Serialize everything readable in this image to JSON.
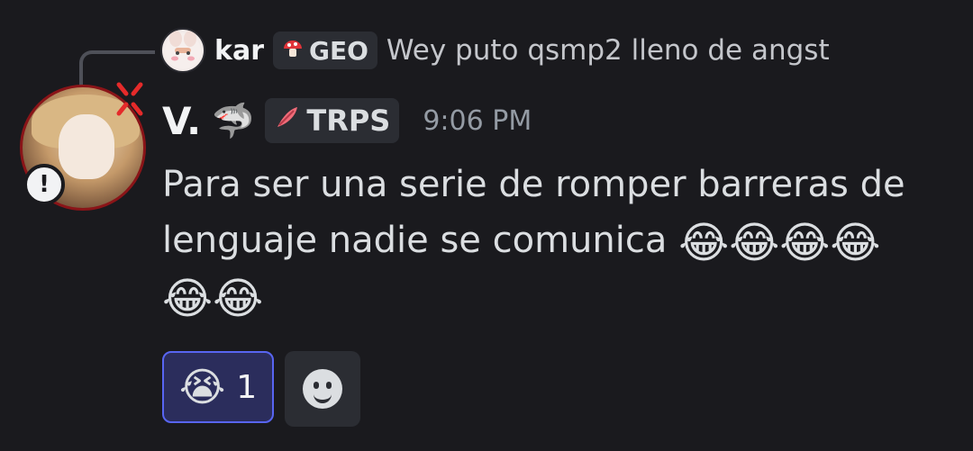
{
  "reply": {
    "author": "kar",
    "tag_icon": "mushroom-icon",
    "tag": "GEO",
    "text": "Wey puto qsmp2 lleno de angst"
  },
  "message": {
    "author": "V.",
    "author_emoji": "🦈",
    "tag_icon": "feather-icon",
    "tag": "TRPS",
    "timestamp": "9:06 PM",
    "text": "Para ser una serie de romper barreras de lenguaje nadie se comunica",
    "emojis": [
      "😂",
      "😂",
      "😂",
      "😂",
      "😂",
      "😂"
    ]
  },
  "reactions": [
    {
      "emoji": "😭",
      "count": "1"
    }
  ],
  "colors": {
    "background": "#1a1a1e",
    "accent": "#5865f2",
    "author_text": "#f2f3f5",
    "timestamp": "#949ba4"
  },
  "icons": {
    "add_reaction": "smile-icon",
    "avatar_anger": "anger-icon",
    "status_badge": "exclamation-icon"
  }
}
